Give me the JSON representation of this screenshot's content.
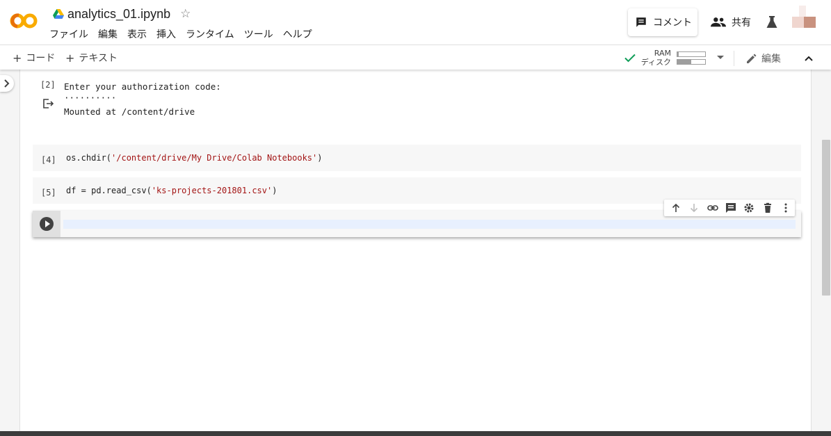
{
  "notebook": {
    "title": "analytics_01.ipynb"
  },
  "menu": [
    "ファイル",
    "編集",
    "表示",
    "挿入",
    "ランタイム",
    "ツール",
    "ヘルプ"
  ],
  "header_actions": {
    "comment": "コメント",
    "share": "共有"
  },
  "toolbar": {
    "add_code": "コード",
    "add_text": "テキスト",
    "edit": "編集"
  },
  "resources": {
    "ram_label": "RAM",
    "disk_label": "ディスク",
    "ram_usage": 0.05,
    "disk_usage": 0.5
  },
  "cells": [
    {
      "exec_count": "[2]",
      "output_lines": [
        "Enter your authorization code:",
        "··········",
        "Mounted at /content/drive"
      ]
    },
    {
      "exec_count": "[4]",
      "code_prefix": "os.chdir(",
      "code_string": "'/content/drive/My Drive/Colab Notebooks'",
      "code_suffix": ")"
    },
    {
      "exec_count": "[5]",
      "code_prefix": "df = pd.read_csv(",
      "code_string": "'ks-projects-201801.csv'",
      "code_suffix": ")"
    }
  ],
  "cell_toolbar_icons": [
    "arrow-up-icon",
    "arrow-down-icon",
    "link-icon",
    "comment-icon",
    "settings-icon",
    "trash-icon",
    "more-vert-icon"
  ],
  "colors": {
    "accent_orange": "#f9ab00",
    "string_red": "#a31515",
    "check_green": "#0f9d58",
    "editor_highlight": "#e8f0fe"
  }
}
